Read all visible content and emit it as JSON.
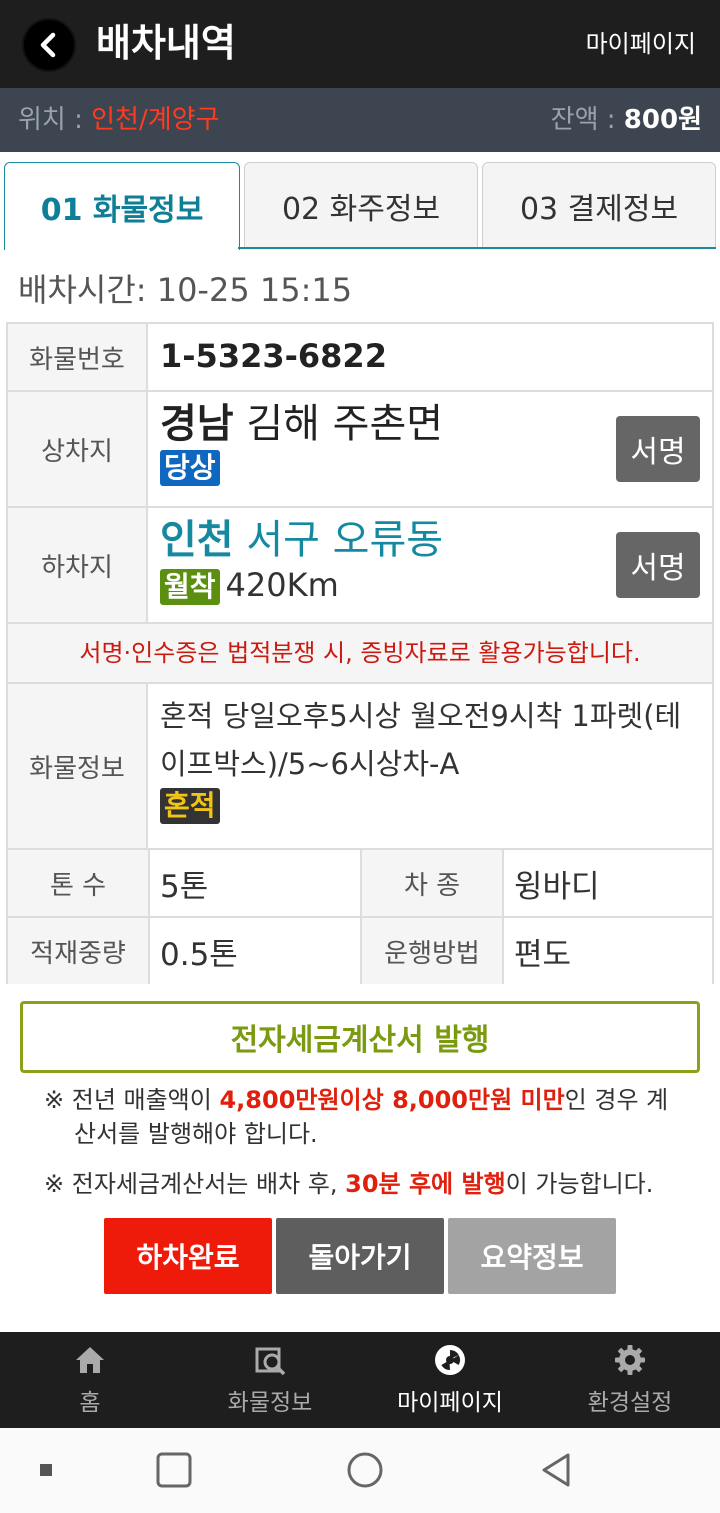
{
  "header": {
    "title": "배차내역",
    "mypage_label": "마이페이지"
  },
  "location_bar": {
    "location_label": "위치 : ",
    "location_value": "인천/계양구",
    "balance_label": "잔액 : ",
    "balance_value": "800원"
  },
  "tabs": [
    {
      "label": "01 화물정보",
      "active": true
    },
    {
      "label": "02 화주정보",
      "active": false
    },
    {
      "label": "03 결제정보",
      "active": false
    }
  ],
  "dispatch_time": "배차시간: 10-25 15:15",
  "info": {
    "cargo_no_label": "화물번호",
    "cargo_no": "1-5323-6822",
    "pickup_label": "상차지",
    "pickup_region": "경남",
    "pickup_rest": " 김해 주촌면",
    "pickup_badge": "당상",
    "sign_label": "서명",
    "dropoff_label": "하차지",
    "dropoff_region": "인천",
    "dropoff_rest": " 서구 오류동",
    "dropoff_badge": "월착",
    "distance": "420Km",
    "notice": "서명·인수증은 법적분쟁 시, 증빙자료로 활용가능합니다.",
    "cargo_info_label": "화물정보",
    "cargo_info_text": "혼적 당일오후5시상 월오전9시착 1파렛(테이프박스)/5~6시상차-A",
    "cargo_info_badge": "혼적",
    "tonnage_label": "톤 수",
    "tonnage": "5톤",
    "vehicle_label": "차 종",
    "vehicle": "윙바디",
    "load_weight_label": "적재중량",
    "load_weight": "0.5톤",
    "operation_label": "운행방법",
    "operation": "편도"
  },
  "tax_invoice": {
    "button_label": "전자세금계산서 발행",
    "note1_prefix": "※ 전년 매출액이 ",
    "note1_highlight": "4,800만원이상 8,000만원 미만",
    "note1_suffix": "인 경우 계산서를 발행해야 합니다.",
    "note2_prefix": "※ 전자세금계산서는 배차 후, ",
    "note2_highlight": "30분 후에 발행",
    "note2_suffix": "이 가능합니다."
  },
  "actions": {
    "complete": "하차완료",
    "back": "돌아가기",
    "summary": "요약정보"
  },
  "bottom_nav": [
    {
      "label": "홈",
      "icon": "home-icon"
    },
    {
      "label": "화물정보",
      "icon": "cargo-search-icon"
    },
    {
      "label": "마이페이지",
      "icon": "mypage-icon",
      "active": true
    },
    {
      "label": "환경설정",
      "icon": "gear-icon"
    }
  ],
  "colors": {
    "header_bg": "#1e1e1e",
    "location_bar_bg": "#3d4650",
    "accent_teal": "#1489a0",
    "alert_red": "#e0200c",
    "invoice_green": "#8aa21a"
  }
}
